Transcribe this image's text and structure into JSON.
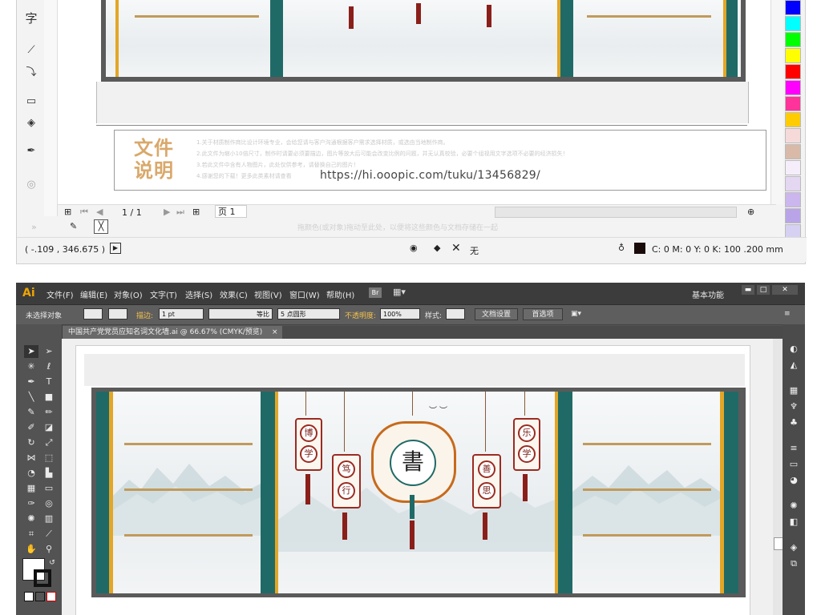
{
  "top_window": {
    "description_title": "文件说明",
    "description_lines": [
      "1.关于材质制作商比设计环境专业，会给您请与客户沟通根据客户需求选择材质，或选由当地制作商。",
      "2.此文件为缩小10倍尺寸，制作时请要必须要描边，图片等放大后可能会改变比例的问题，并无认真校验，必要个组视用文字选项不必要的经济损失！",
      "3.若此文件中含有人物图片，此处仅供参考，请替换自己的图片！",
      "4.感谢您的下载！更多此类素材请查看"
    ],
    "url": "https://hi.ooopic.com/tuku/13456829/",
    "page_indicator": "1 / 1",
    "page_tab": "页 1",
    "status_hint": "拖颜色(或对象)拖动至此处，以便将这些颜色与文档存储在一起",
    "coordinates": "( -.109 , 346.675 )",
    "fill_label": "无",
    "color_readout": "C: 0 M: 0 Y: 0 K: 100  .200 mm",
    "toolbox_char": "字",
    "palette": [
      "#0000ff",
      "#00ffff",
      "#00ff00",
      "#ffff00",
      "#ff0000",
      "#ff00ff",
      "#ff3399",
      "#ffcc00",
      "#f6dada",
      "#d9b9a8",
      "#f5eefa",
      "#e4d7f2",
      "#cbb6ee",
      "#b9a4e8",
      "#d6d0f2"
    ]
  },
  "ai_window": {
    "app_logo": "Ai",
    "menus": [
      "文件(F)",
      "编辑(E)",
      "对象(O)",
      "文字(T)",
      "选择(S)",
      "效果(C)",
      "视图(V)",
      "窗口(W)",
      "帮助(H)"
    ],
    "br_label": "Br",
    "workspace": "基本功能",
    "control": {
      "no_selection": "未选择对象",
      "stroke_label": "描边:",
      "stroke_value": "1 pt",
      "stroke_style": "等比",
      "brush": "5 点圆形",
      "opacity_label": "不透明度:",
      "opacity_value": "100%",
      "style_label": "样式:",
      "doc_settings": "文档设置",
      "preferences": "首选项"
    },
    "tab_title": "中国共产党党员应知名词文化墙.ai @ 66.67% (CMYK/预览)",
    "tab_close": "×"
  },
  "mural": {
    "center_char": "書",
    "lantern_left_outer": [
      "博",
      "学"
    ],
    "lantern_left_inner": [
      "笃",
      "行"
    ],
    "lantern_right_inner": [
      "善",
      "思"
    ],
    "lantern_right_outer": [
      "乐",
      "学"
    ]
  }
}
